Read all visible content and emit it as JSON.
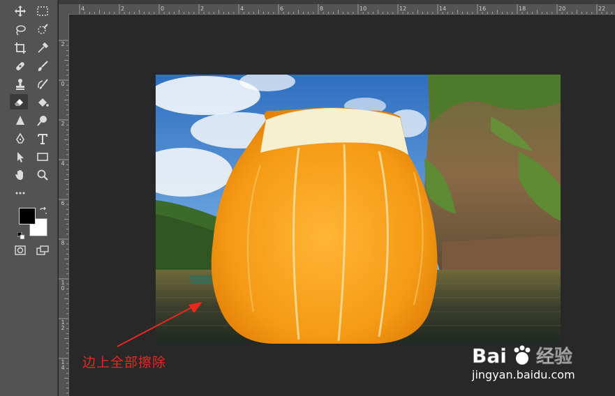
{
  "tools": [
    {
      "name": "move-tool-icon"
    },
    {
      "name": "rectangular-marquee-icon"
    },
    {
      "name": "lasso-tool-icon"
    },
    {
      "name": "quick-selection-icon"
    },
    {
      "name": "crop-tool-icon"
    },
    {
      "name": "eyedropper-icon"
    },
    {
      "name": "healing-brush-icon"
    },
    {
      "name": "brush-tool-icon"
    },
    {
      "name": "clone-stamp-icon"
    },
    {
      "name": "history-brush-icon"
    },
    {
      "name": "eraser-tool-icon"
    },
    {
      "name": "paint-bucket-icon"
    },
    {
      "name": "blur-tool-icon"
    },
    {
      "name": "dodge-tool-icon"
    },
    {
      "name": "pen-tool-icon"
    },
    {
      "name": "type-tool-icon"
    },
    {
      "name": "path-selection-icon"
    },
    {
      "name": "rectangle-tool-icon"
    },
    {
      "name": "hand-tool-icon"
    },
    {
      "name": "zoom-tool-icon"
    }
  ],
  "colors": {
    "foreground": "#000000",
    "background": "#ffffff",
    "annotation": "#e8281e"
  },
  "ruler": {
    "h_labels": [
      "4",
      "2",
      "0",
      "2",
      "4",
      "6",
      "8",
      "10",
      "12",
      "14",
      "16",
      "18",
      "20",
      "22"
    ],
    "v_labels": [
      "2",
      "0",
      "2",
      "4",
      "6",
      "8",
      "1 0",
      "1 2",
      "1 4"
    ]
  },
  "annotation": {
    "text": "边上全部擦除"
  },
  "watermark": {
    "brand": "Bai",
    "brand2": "du",
    "cn": "经验",
    "url": "jingyan.baidu.com"
  }
}
